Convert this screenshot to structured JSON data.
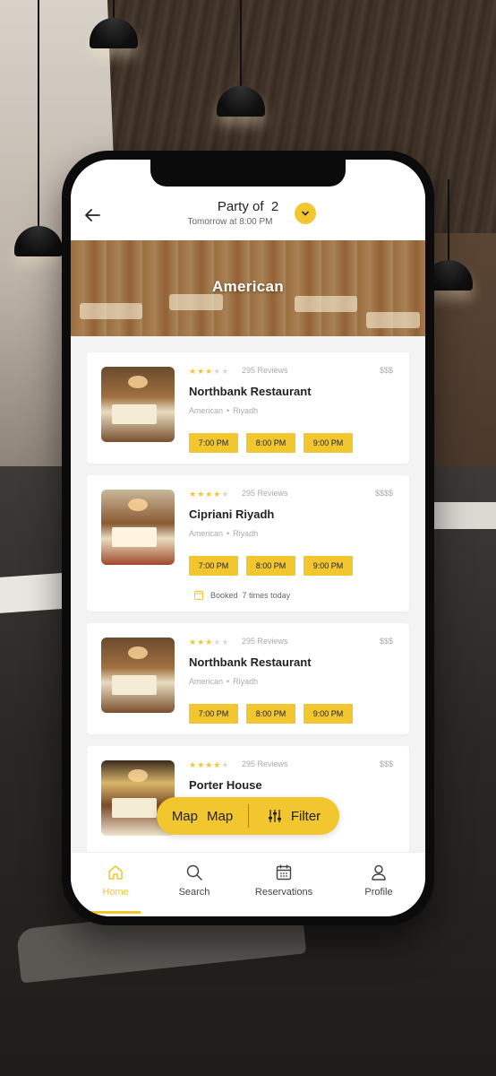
{
  "header": {
    "party_label": "Party of",
    "party_size": "2",
    "subtitle": "Tomorrow at 8:00 PM"
  },
  "banner": {
    "title": "American"
  },
  "restaurants": [
    {
      "rating": 3,
      "reviews": "295 Reviews",
      "price": "$$$",
      "name": "Northbank Restaurant",
      "cuisine": "American",
      "city": "Riyadh",
      "times": [
        "7:00 PM",
        "8:00 PM",
        "9:00 PM"
      ]
    },
    {
      "rating": 4,
      "reviews": "295 Reviews",
      "price": "$$$$",
      "name": "Cipriani Riyadh",
      "cuisine": "American",
      "city": "Riyadh",
      "times": [
        "7:00 PM",
        "8:00 PM",
        "9:00 PM"
      ],
      "booked_label": "Booked",
      "booked_count": "7",
      "booked_suffix": "times today"
    },
    {
      "rating": 3,
      "reviews": "295 Reviews",
      "price": "$$$",
      "name": "Northbank Restaurant",
      "cuisine": "American",
      "city": "Riyadh",
      "times": [
        "7:00 PM",
        "8:00 PM",
        "9:00 PM"
      ]
    },
    {
      "rating": 4,
      "reviews": "295 Reviews",
      "price": "$$$",
      "name": "Porter House"
    }
  ],
  "floating": {
    "map_icon_label": "Map",
    "map_label": "Map",
    "filter_label": "Filter"
  },
  "nav": {
    "items": [
      {
        "label": "Home",
        "icon": "home-icon",
        "active": true
      },
      {
        "label": "Search",
        "icon": "search-icon",
        "active": false
      },
      {
        "label": "Reservations",
        "icon": "calendar-icon",
        "active": false
      },
      {
        "label": "Profile",
        "icon": "user-icon",
        "active": false
      }
    ]
  },
  "colors": {
    "accent": "#f2c62f",
    "text": "#222222",
    "muted": "#aaaaaa"
  }
}
